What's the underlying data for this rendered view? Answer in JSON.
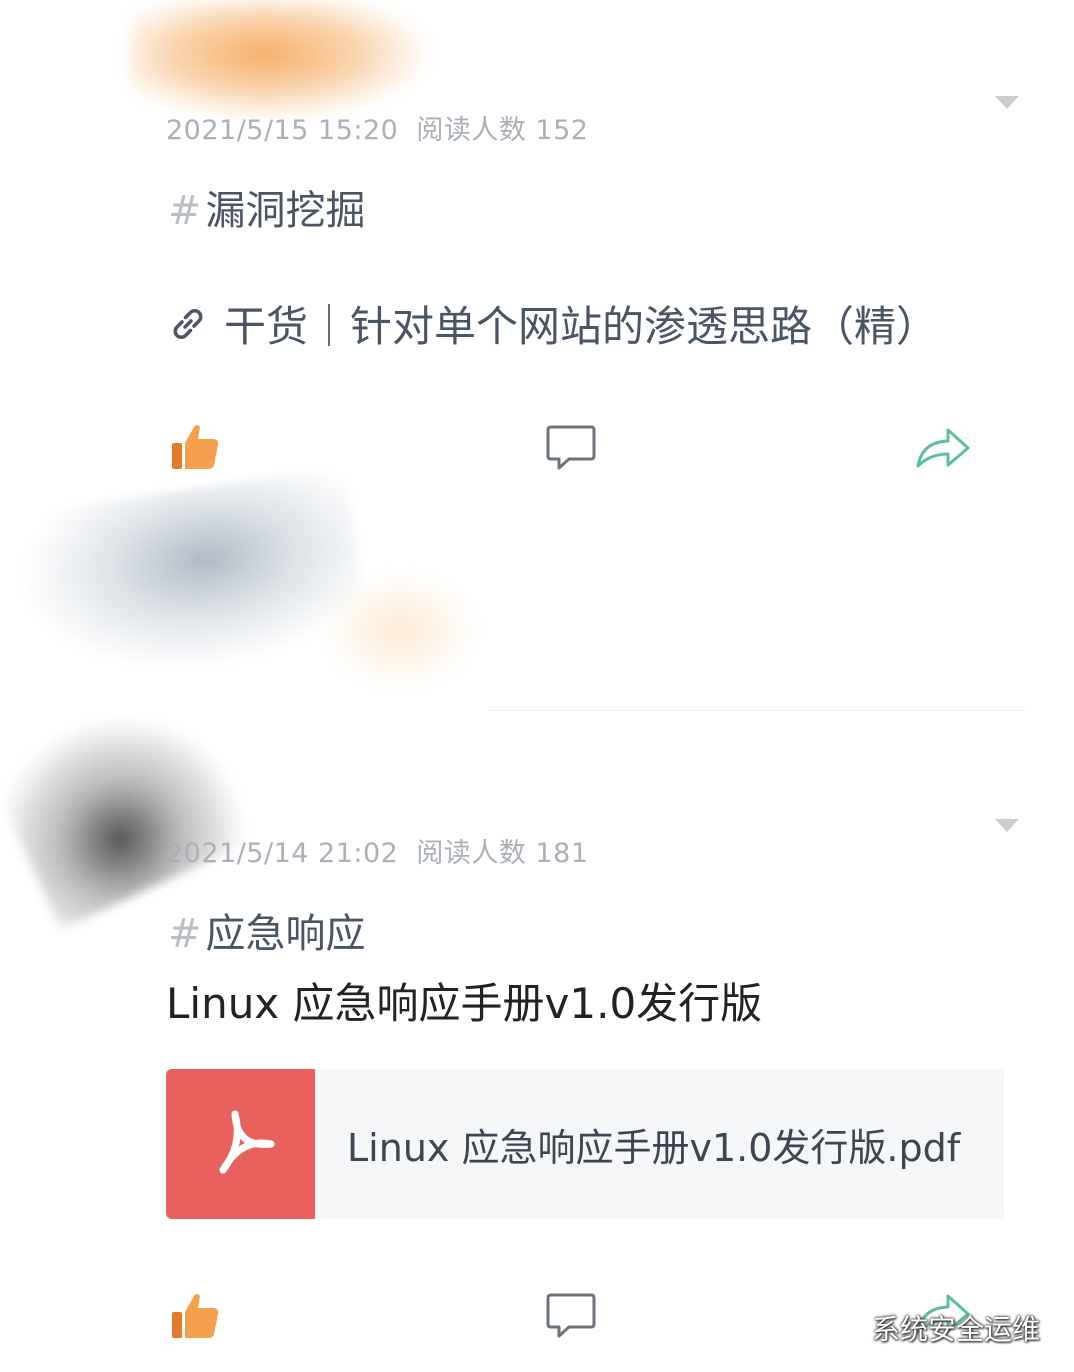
{
  "posts": [
    {
      "date": "2021/5/15 15:20",
      "reads": "阅读人数 152",
      "tag": "漏洞挖掘",
      "link_text": "干货｜针对单个网站的渗透思路（精）"
    },
    {
      "date": "2021/5/14 21:02",
      "reads": "阅读人数 181",
      "tag": "应急响应",
      "title": "Linux  应急响应手册v1.0发行版",
      "attachment": {
        "file_name": "Linux 应急响应手册v1.0发行版.pdf",
        "icon": "pdf-icon"
      }
    }
  ],
  "hash_symbol": "#",
  "watermark": "系统安全运维",
  "colors": {
    "like": "#f08c3c",
    "share": "#5bbf98",
    "pdf": "#e8615c"
  }
}
